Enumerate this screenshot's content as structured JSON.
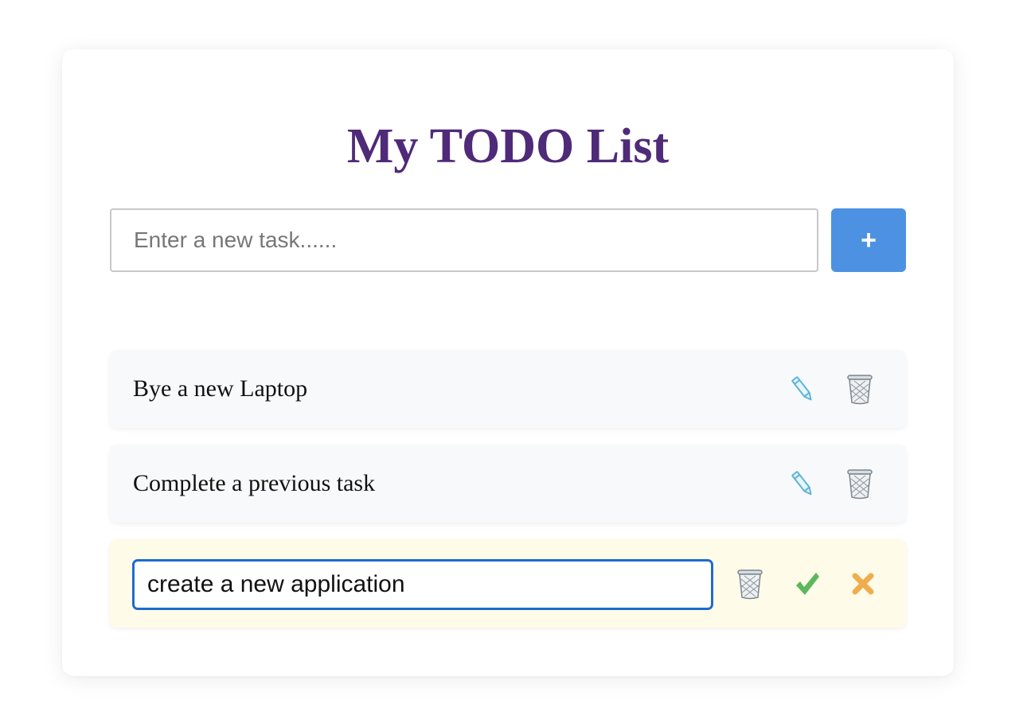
{
  "app": {
    "title": "My TODO List"
  },
  "new_task": {
    "placeholder": "Enter a new task......",
    "value": "",
    "add_label": "+"
  },
  "tasks": [
    {
      "text": "Bye a new Laptop",
      "state": "view",
      "actions": [
        "pencil-icon",
        "trash-icon"
      ]
    },
    {
      "text": "Complete a previous task",
      "state": "view",
      "actions": [
        "pencil-icon",
        "trash-icon"
      ]
    },
    {
      "text": "create a new application",
      "state": "editing",
      "actions": [
        "trash-icon",
        "check-icon",
        "cross-icon"
      ]
    }
  ],
  "colors": {
    "title": "#4f2a78",
    "add_button": "#4d92e2",
    "item_background": "#f8f9fa",
    "editing_background": "#fffbe9",
    "edit_focus_border": "#1d6bd1",
    "pencil": "#5fb4d6",
    "check": "#5cb85c",
    "cross": "#f0ad4e"
  }
}
